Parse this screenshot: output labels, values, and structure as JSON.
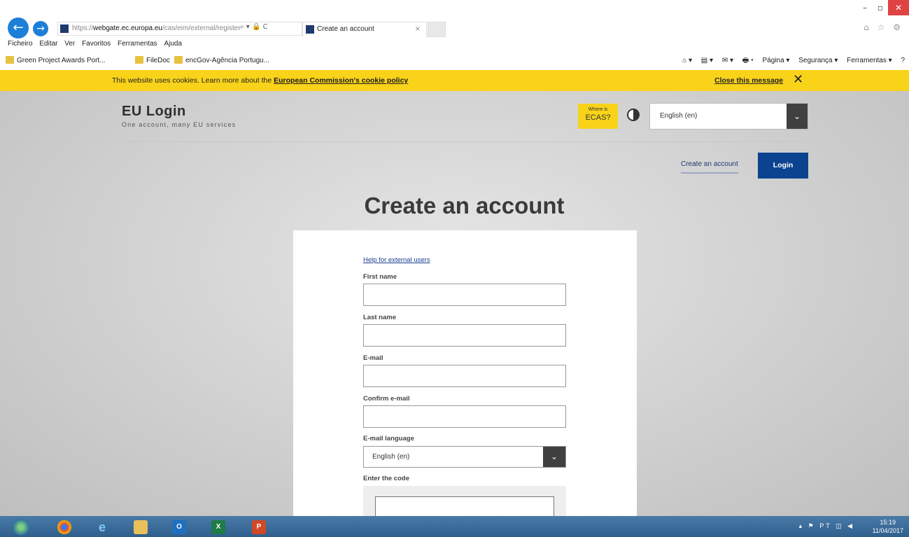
{
  "browser": {
    "address_prefix": "https://",
    "address_host": "webgate.ec.europa.eu",
    "address_path": "/cas/eim/external/register",
    "address_icons": "⌕ ▾ 🔒 C",
    "tab_title": "Create an account",
    "tab_close": "×",
    "window_controls": [
      "–",
      "▫",
      "✕"
    ],
    "right_icons": "⌂ ☆ ⚙",
    "menu_items": [
      "Ficheiro",
      "Editar",
      "Ver",
      "Favoritos",
      "Ferramentas",
      "Ajuda"
    ],
    "favorites": [
      "Green Project Awards Port...",
      "FileDoc",
      "encGov-Agência Portugu..."
    ],
    "toolbar_items": [
      "⌂ ▾",
      "▤ ▾",
      "✉ ▾",
      "🖶 ▾",
      "Página ▾",
      "Segurança ▾",
      "Ferramentas ▾",
      "?"
    ]
  },
  "cookie_banner": {
    "text": "This website uses cookies. Learn more about the ",
    "link": "European Commission's cookie policy",
    "close_label": "Close this message",
    "close_icon": "✕",
    "color": "#f9d31a"
  },
  "header": {
    "brand_title": "EU Login",
    "brand_subtitle": "One account, many EU services",
    "ecas_small": "Where is",
    "ecas_big": "ECAS?",
    "language": "English (en)",
    "dropdown_icon": "⌄",
    "create_account_link": "Create an account",
    "login_button": "Login",
    "accent_color": "#0b4390"
  },
  "main": {
    "title": "Create an account",
    "help_link": "Help for external users",
    "fields": {
      "first_name": "First name",
      "last_name": "Last name",
      "email": "E-mail",
      "confirm_email": "Confirm e-mail",
      "email_language": "E-mail language",
      "enter_code": "Enter the code"
    },
    "email_language_value": "English (en)"
  },
  "taskbar": {
    "apps": [
      "",
      "",
      "e",
      "",
      "O",
      "X",
      "P"
    ],
    "tray_icons": "▴ ⚑ PT ◫ ◀",
    "time": "15:19",
    "date": "11/04/2017"
  }
}
